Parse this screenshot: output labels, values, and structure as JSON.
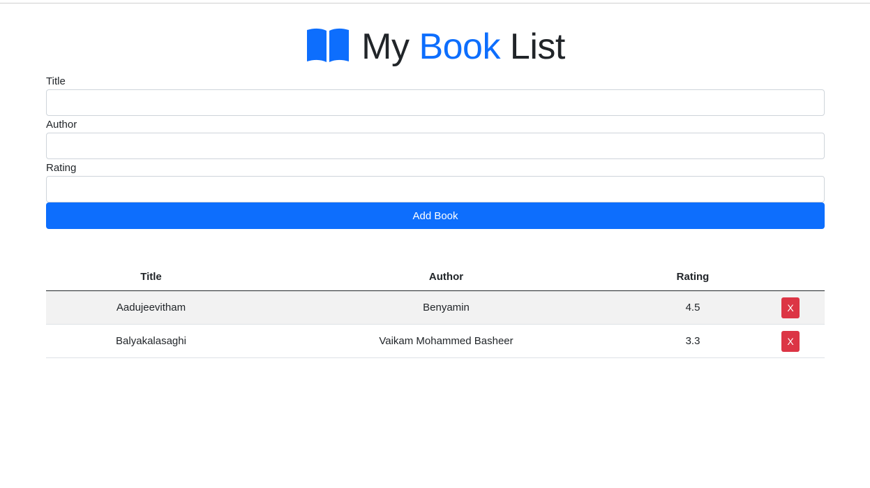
{
  "header": {
    "title_part1": "My",
    "title_part2": "Book",
    "title_part3": "List",
    "icon": "book-open-icon",
    "accent_color": "#0d6efd"
  },
  "form": {
    "title_label": "Title",
    "title_value": "",
    "author_label": "Author",
    "author_value": "",
    "rating_label": "Rating",
    "rating_value": "",
    "submit_label": "Add Book"
  },
  "table": {
    "headers": [
      "Title",
      "Author",
      "Rating",
      ""
    ],
    "rows": [
      {
        "title": "Aadujeevitham",
        "author": "Benyamin",
        "rating": "4.5",
        "delete_label": "X"
      },
      {
        "title": "Balyakalasaghi",
        "author": "Vaikam Mohammed Basheer",
        "rating": "3.3",
        "delete_label": "X"
      }
    ]
  },
  "colors": {
    "primary": "#0d6efd",
    "danger": "#dc3545"
  }
}
